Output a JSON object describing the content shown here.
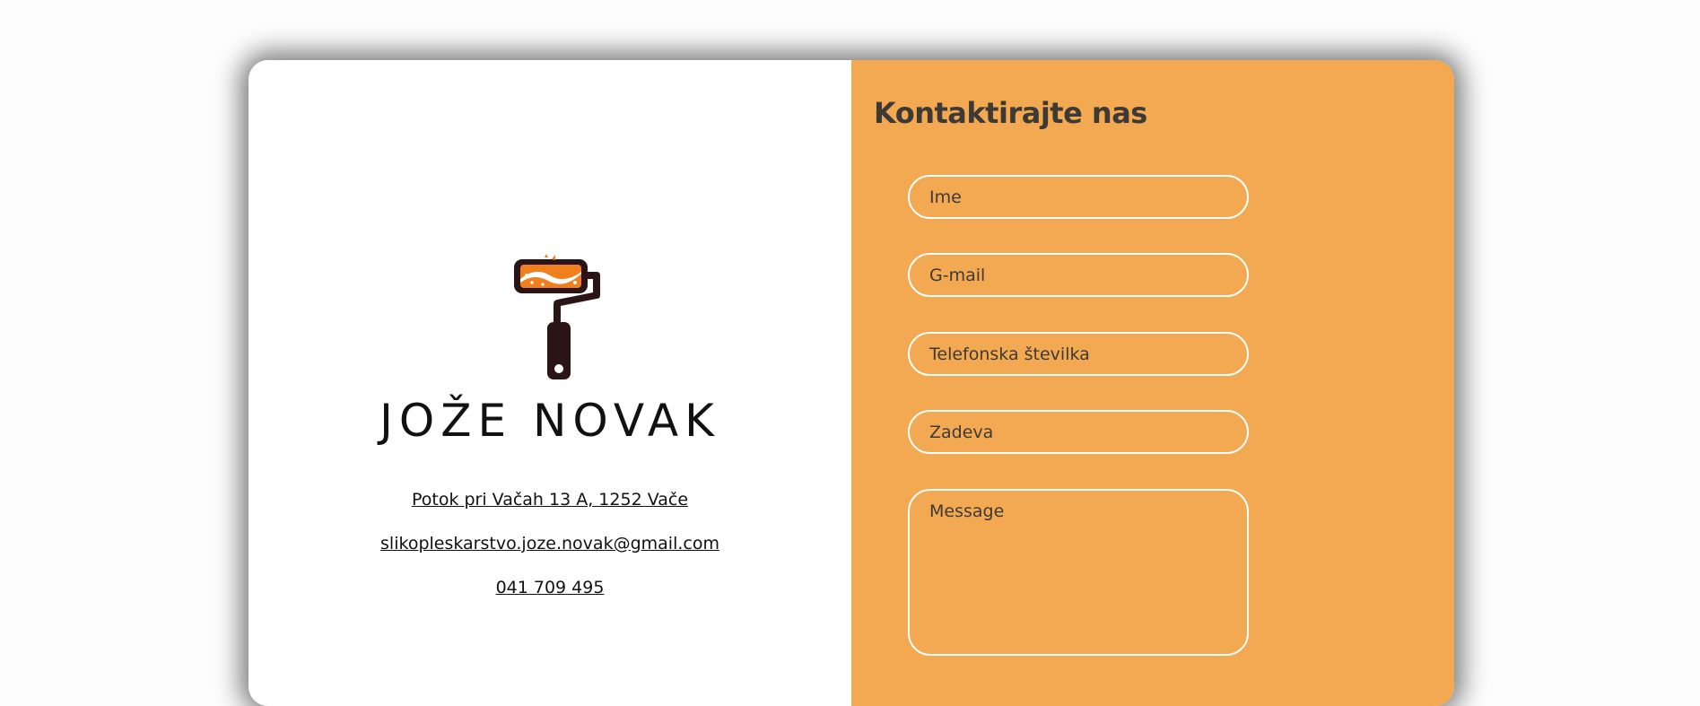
{
  "brand": {
    "name": "JOŽE NOVAK",
    "logo_icon": "paint-roller-icon",
    "colors": {
      "accent": "#f07f1e",
      "dark": "#2a1416"
    }
  },
  "contact": {
    "address": "Potok pri Vačah 13 A, 1252 Vače",
    "email": "slikopleskarstvo.joze.novak@gmail.com",
    "phone": "041 709 495"
  },
  "form": {
    "title": "Kontaktirajte nas",
    "name_placeholder": "Ime",
    "email_placeholder": "G-mail",
    "phone_placeholder": "Telefonska številka",
    "subject_placeholder": "Zadeva",
    "message_placeholder": "Message"
  },
  "theme": {
    "panel_color": "#f3a951",
    "border_color": "#ffffff"
  }
}
